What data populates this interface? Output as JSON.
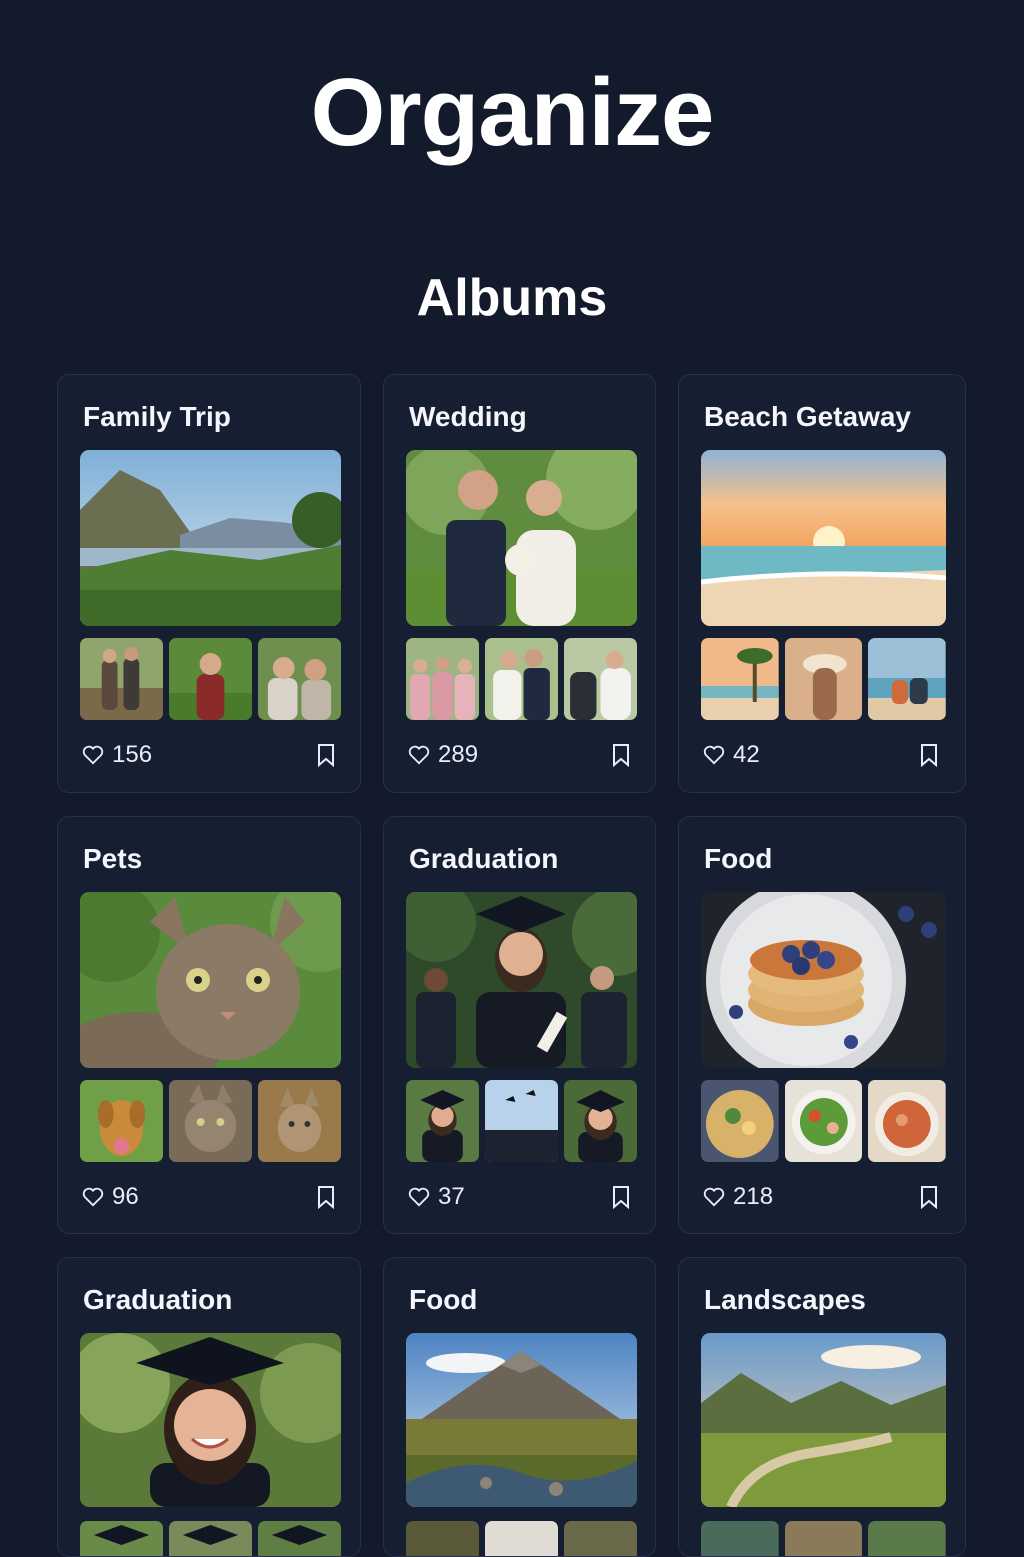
{
  "header": {
    "title": "Organize",
    "subtitle": "Albums"
  },
  "albums": [
    {
      "title": "Family Trip",
      "likes": "156",
      "cover": "mountain-valley",
      "thumbs": [
        "couple-outdoors",
        "boy-in-park",
        "two-women-smiling"
      ]
    },
    {
      "title": "Wedding",
      "likes": "289",
      "cover": "bride-and-groom",
      "thumbs": [
        "bridesmaids",
        "wedding-couple-kiss",
        "bride-and-guests"
      ]
    },
    {
      "title": "Beach Getaway",
      "likes": "42",
      "cover": "beach-sunset",
      "thumbs": [
        "palm-tree-beach",
        "woman-in-sunhat",
        "couple-on-beach"
      ]
    },
    {
      "title": "Pets",
      "likes": "96",
      "cover": "tabby-cat",
      "thumbs": [
        "golden-dog",
        "tabby-cat-portrait",
        "kitten"
      ]
    },
    {
      "title": "Graduation",
      "likes": "37",
      "cover": "smiling-graduate",
      "thumbs": [
        "graduate-portrait",
        "caps-thrown",
        "graduate-smiling"
      ]
    },
    {
      "title": "Food",
      "likes": "218",
      "cover": "blueberry-pancakes",
      "thumbs": [
        "egg-dish",
        "salad-bowl",
        "pasta-bowl"
      ]
    },
    {
      "title": "Graduation",
      "likes": "",
      "cover": "graduate-closeup",
      "thumbs": []
    },
    {
      "title": "Food",
      "likes": "",
      "cover": "mountain-river",
      "thumbs": []
    },
    {
      "title": "Landscapes",
      "likes": "",
      "cover": "green-valley-road",
      "thumbs": []
    }
  ],
  "icons": {
    "like": "heart-icon",
    "save": "bookmark-icon"
  },
  "colors": {
    "background": "#131a2b",
    "card": "#161e32",
    "border": "#263049",
    "text": "#ffffff"
  }
}
